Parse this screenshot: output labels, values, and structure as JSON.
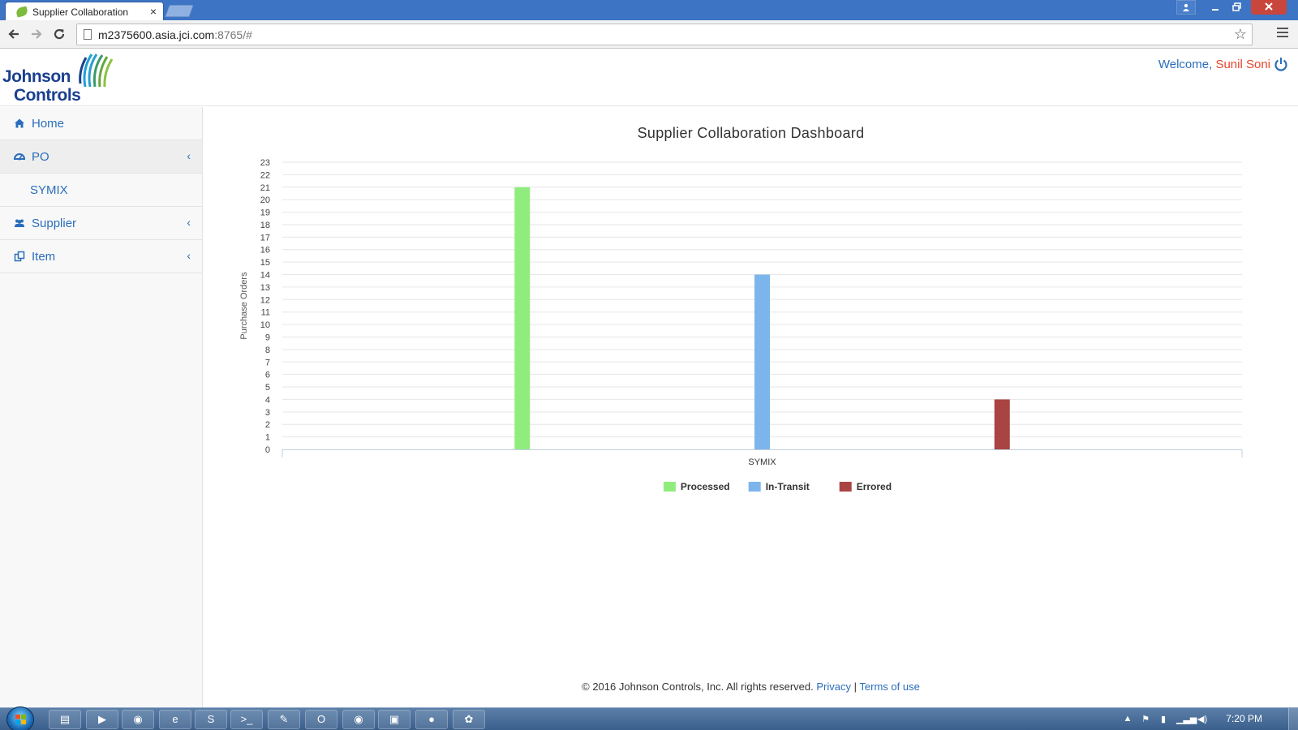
{
  "browser": {
    "tab_title": "Supplier Collaboration",
    "tab_close": "×",
    "url_host": "m2375600.asia.jci.com",
    "url_rest": ":8765/#"
  },
  "header": {
    "logo_line1": "Johnson",
    "logo_line2": "Controls",
    "welcome_prefix": "Welcome,",
    "user_name": "Sunil Soni"
  },
  "sidebar": {
    "items": [
      {
        "label": "Home",
        "icon": "home-icon"
      },
      {
        "label": "PO",
        "icon": "dashboard-icon",
        "chevron": "‹"
      },
      {
        "label": "SYMIX"
      },
      {
        "label": "Supplier",
        "icon": "users-icon",
        "chevron": "‹"
      },
      {
        "label": "Item",
        "icon": "items-icon",
        "chevron": "‹"
      }
    ]
  },
  "chart_data": {
    "type": "bar",
    "title": "Supplier Collaboration Dashboard",
    "ylabel": "Purchase Orders",
    "xlabel": "",
    "ylim": [
      0,
      23
    ],
    "yticks": [
      0,
      1,
      2,
      3,
      4,
      5,
      6,
      7,
      8,
      9,
      10,
      11,
      12,
      13,
      14,
      15,
      16,
      17,
      18,
      19,
      20,
      21,
      22,
      23
    ],
    "categories": [
      "SYMIX"
    ],
    "series": [
      {
        "name": "Processed",
        "values": [
          21
        ],
        "color": "#90ed7d"
      },
      {
        "name": "In-Transit",
        "values": [
          14
        ],
        "color": "#7cb5ec"
      },
      {
        "name": "Errored",
        "values": [
          4
        ],
        "color": "#a94442"
      }
    ],
    "legend_position": "bottom-center",
    "grid": true
  },
  "footer": {
    "copyright": "© 2016 Johnson Controls, Inc. All rights reserved.",
    "privacy": "Privacy",
    "separator": "|",
    "terms": "Terms of use"
  },
  "taskbar": {
    "clock": "7:20 PM",
    "apps": [
      "file-explorer-icon",
      "media-player-icon",
      "chrome-icon",
      "internet-explorer-icon",
      "skype-icon",
      "command-prompt-icon",
      "notepad-icon",
      "outlook-icon",
      "chrome-icon",
      "remote-desktop-icon",
      "vodafone-icon",
      "paint-icon"
    ]
  }
}
